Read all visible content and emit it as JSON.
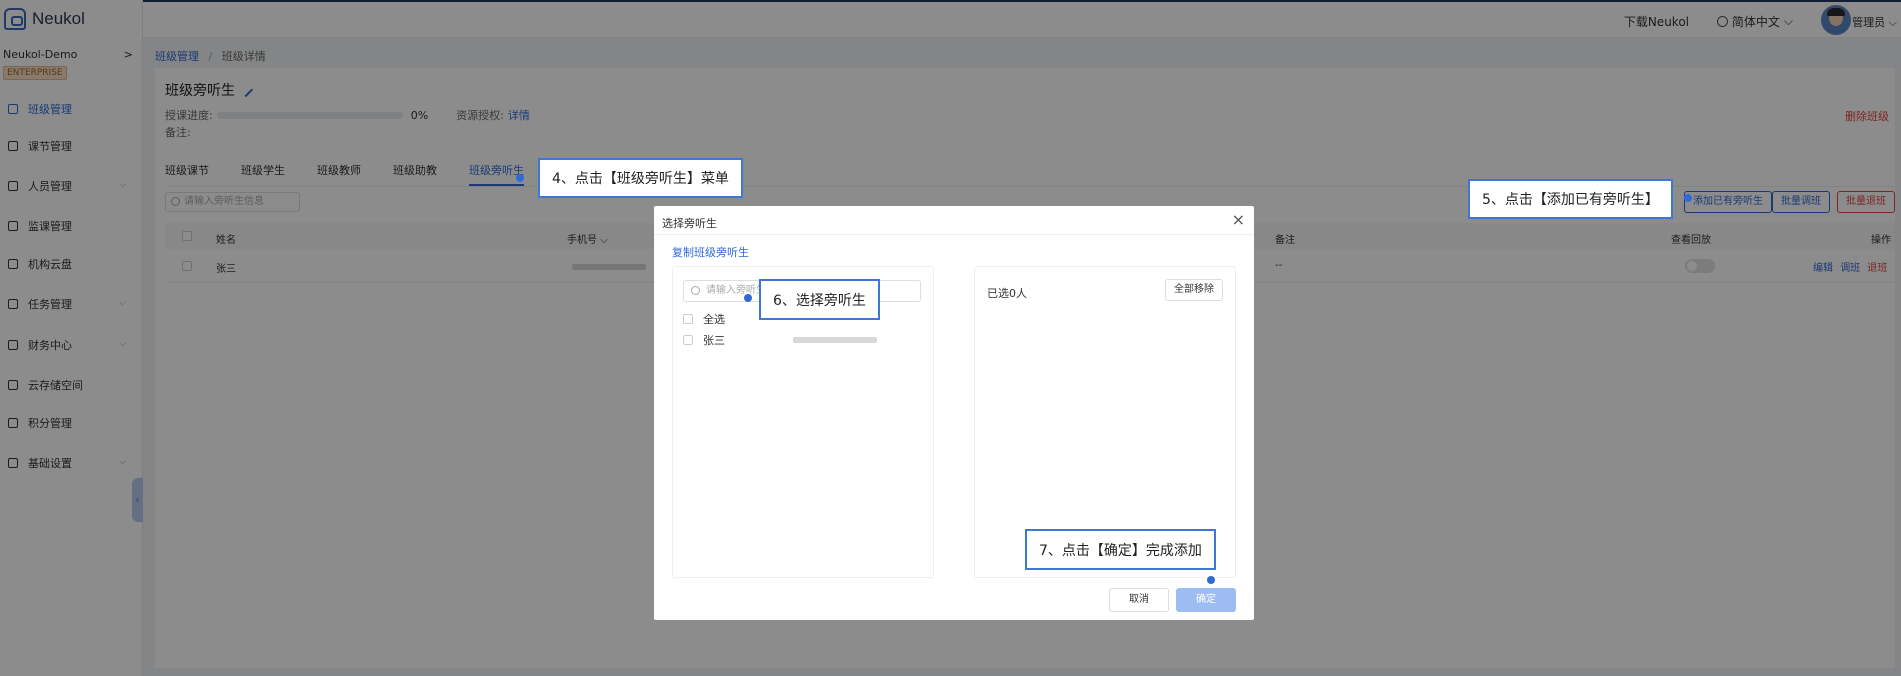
{
  "app": {
    "name": "Neukol",
    "org": "Neukol-Demo",
    "edition": "ENTERPRISE"
  },
  "sidebar": {
    "items": [
      {
        "label": "班级管理",
        "active": true,
        "expandable": false
      },
      {
        "label": "课节管理",
        "active": false,
        "expandable": false
      },
      {
        "label": "人员管理",
        "active": false,
        "expandable": true
      },
      {
        "label": "监课管理",
        "active": false,
        "expandable": false
      },
      {
        "label": "机构云盘",
        "active": false,
        "expandable": false
      },
      {
        "label": "任务管理",
        "active": false,
        "expandable": true
      },
      {
        "label": "财务中心",
        "active": false,
        "expandable": true
      },
      {
        "label": "云存储空间",
        "active": false,
        "expandable": false
      },
      {
        "label": "积分管理",
        "active": false,
        "expandable": false
      },
      {
        "label": "基础设置",
        "active": false,
        "expandable": true
      }
    ]
  },
  "header": {
    "download": "下载Neukol",
    "language": "简体中文",
    "user": "管理员"
  },
  "breadcrumb": {
    "root": "班级管理",
    "separator": "/",
    "current": "班级详情"
  },
  "page": {
    "title": "班级旁听生",
    "progress_label": "授课进度:",
    "progress_value": "0%",
    "progress_fraction": 0,
    "resource_label": "资源授权:",
    "resource_link": "详情",
    "note_label": "备注:",
    "delete_class": "删除班级"
  },
  "tabs": [
    "班级课节",
    "班级学生",
    "班级教师",
    "班级助教",
    "班级旁听生"
  ],
  "active_tab": 4,
  "toolbar": {
    "search_placeholder": "请输入旁听生信息",
    "add_existing": "添加已有旁听生",
    "batch_transfer": "批量调班",
    "batch_withdraw": "批量退班"
  },
  "table": {
    "columns": [
      "姓名",
      "手机号",
      "备注",
      "查看回放",
      "操作"
    ],
    "rows": [
      {
        "name": "张三",
        "note": "--",
        "actions": [
          "编辑",
          "调班",
          "退班"
        ]
      }
    ]
  },
  "modal": {
    "title": "选择旁听生",
    "copy_link": "复制班级旁听生",
    "search_placeholder": "请输入旁听生",
    "select_all": "全选",
    "options": [
      "张三"
    ],
    "selected_count": "已选0人",
    "remove_all": "全部移除",
    "cancel": "取消",
    "confirm": "确定"
  },
  "callouts": {
    "step4": "4、点击【班级旁听生】菜单",
    "step5": "5、点击【添加已有旁听生】",
    "step6": "6、选择旁听生",
    "step7": "7、点击【确定】完成添加"
  },
  "colors": {
    "primary": "#2f6bd6",
    "danger": "#e0453d",
    "callout_border": "#3f77d8"
  }
}
